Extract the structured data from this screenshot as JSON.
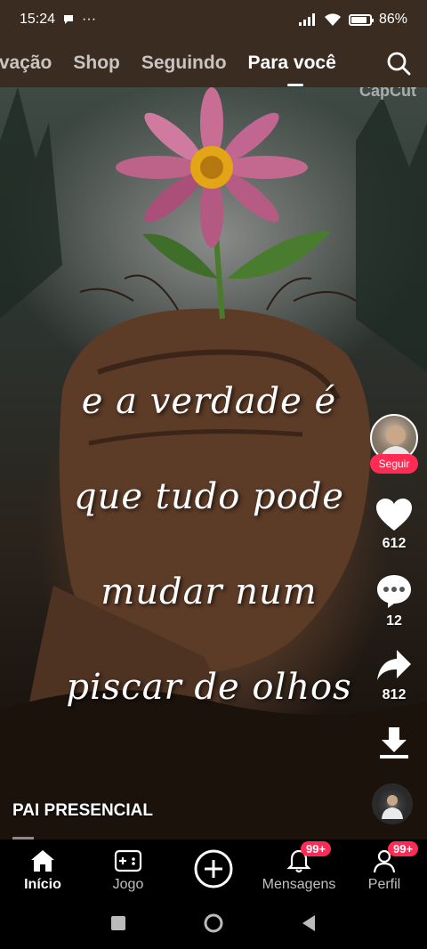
{
  "status_bar": {
    "time": "15:24",
    "dots": "···",
    "battery": "86%",
    "battery_level": 0.86
  },
  "top_nav": {
    "tabs": [
      {
        "label": "tivação"
      },
      {
        "label": "Shop"
      },
      {
        "label": "Seguindo"
      },
      {
        "label": "Para você",
        "active": true
      }
    ]
  },
  "video": {
    "watermark": "CapCut",
    "caption_lines": [
      "e a verdade é",
      "que tudo pode",
      "mudar num",
      "piscar de olhos"
    ],
    "author": "PAI PRESENCIAL"
  },
  "actions": {
    "follow_label": "Seguir",
    "likes": "612",
    "comments": "12",
    "shares": "812"
  },
  "bottom_nav": {
    "home": "Início",
    "games": "Jogo",
    "messages": "Mensagens",
    "messages_badge": "99+",
    "profile": "Perfil",
    "profile_badge": "99+"
  },
  "colors": {
    "accent": "#fe2c55",
    "top_bar": "#3b2c22"
  }
}
